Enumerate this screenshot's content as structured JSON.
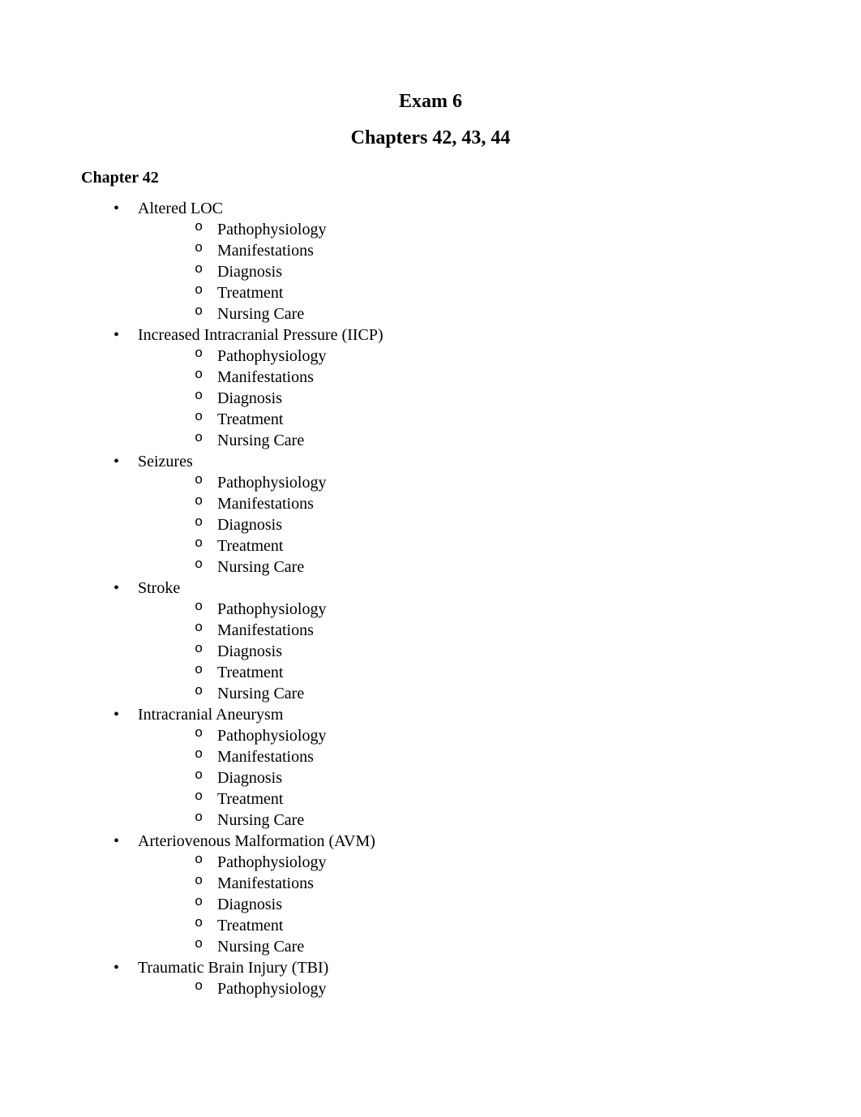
{
  "title": "Exam 6",
  "subtitle": "Chapters 42, 43, 44",
  "section_heading": "Chapter 42",
  "topics": [
    {
      "label": "Altered LOC",
      "subitems": [
        "Pathophysiology",
        "Manifestations",
        "Diagnosis",
        "Treatment",
        "Nursing Care"
      ]
    },
    {
      "label": "Increased Intracranial Pressure (IICP)",
      "subitems": [
        "Pathophysiology",
        "Manifestations",
        "Diagnosis",
        "Treatment",
        "Nursing Care"
      ]
    },
    {
      "label": "Seizures",
      "subitems": [
        "Pathophysiology",
        "Manifestations",
        "Diagnosis",
        "Treatment",
        "Nursing Care"
      ]
    },
    {
      "label": "Stroke",
      "subitems": [
        "Pathophysiology",
        "Manifestations",
        "Diagnosis",
        "Treatment",
        "Nursing Care"
      ]
    },
    {
      "label": "Intracranial Aneurysm",
      "subitems": [
        "Pathophysiology",
        "Manifestations",
        "Diagnosis",
        "Treatment",
        "Nursing Care"
      ]
    },
    {
      "label": "Arteriovenous Malformation (AVM)",
      "subitems": [
        "Pathophysiology",
        "Manifestations",
        "Diagnosis",
        "Treatment",
        "Nursing Care"
      ]
    },
    {
      "label": "Traumatic Brain Injury (TBI)",
      "subitems": [
        "Pathophysiology"
      ]
    }
  ]
}
